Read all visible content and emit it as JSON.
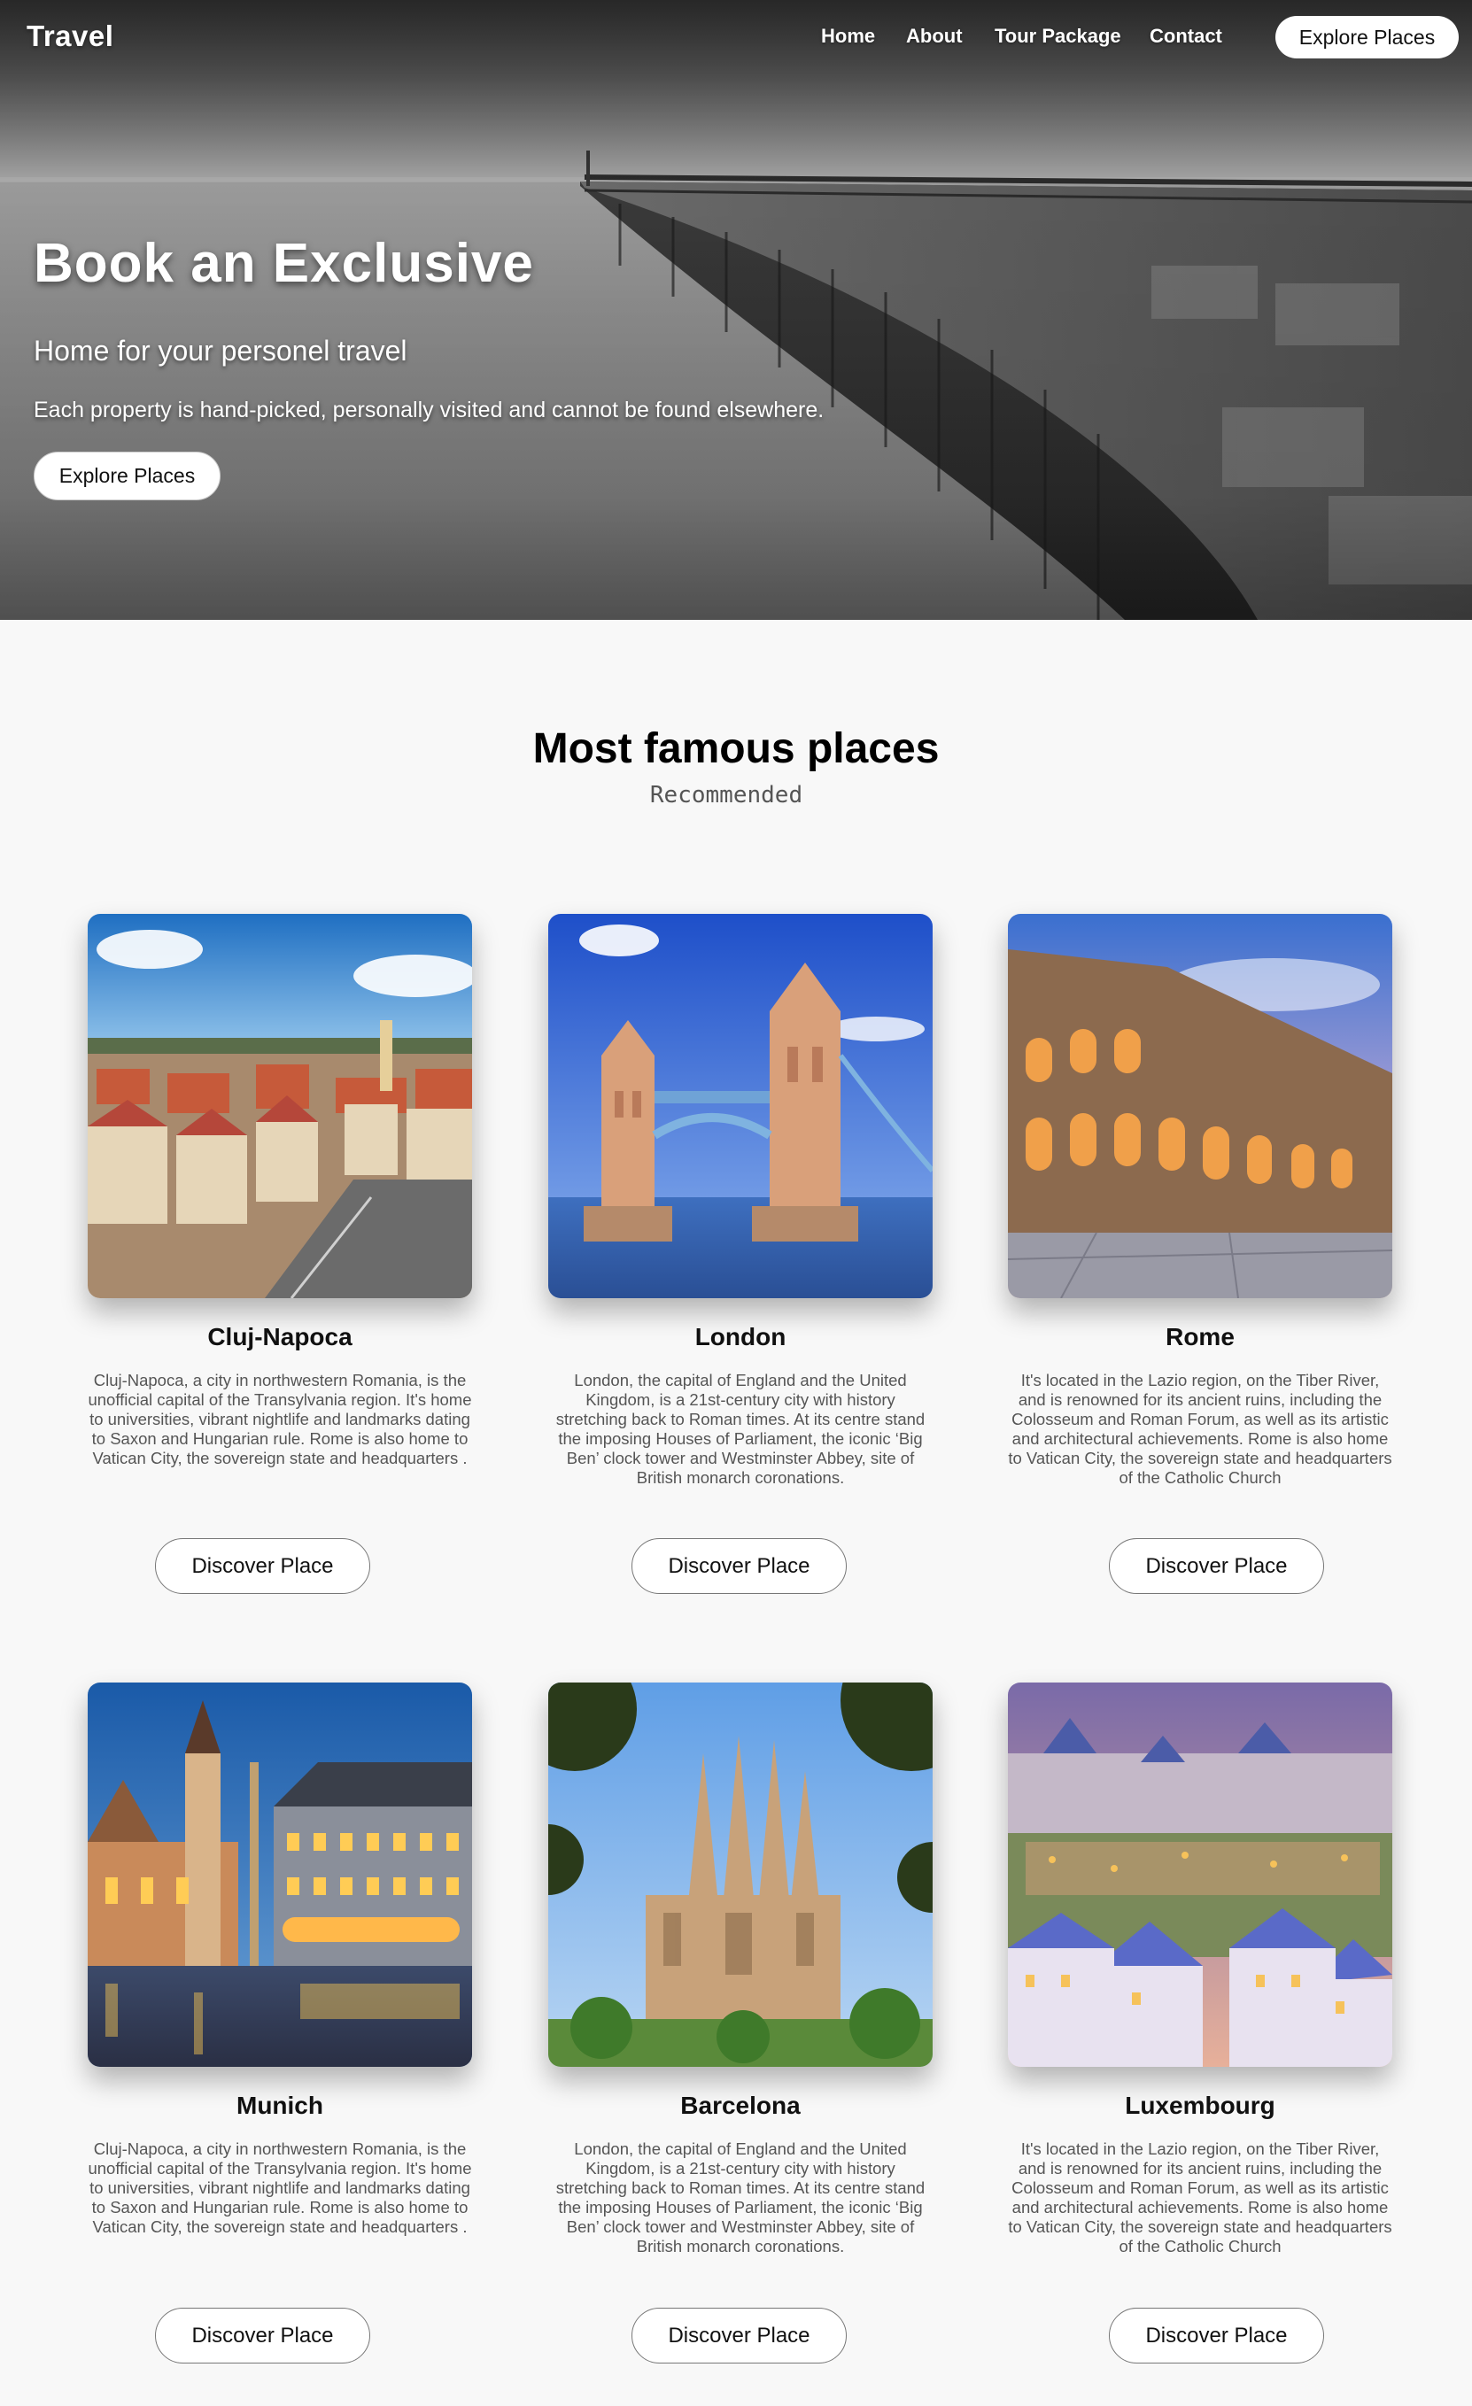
{
  "nav": {
    "logo": "Travel",
    "links": [
      "Home",
      "About",
      "Tour Package",
      "Contact"
    ],
    "cta": "Explore Places"
  },
  "hero": {
    "title": "Book an Exclusive",
    "subtitle": "Home for your personel travel",
    "description": "Each property is hand-picked, personally visited and cannot be found elsewhere.",
    "cta": "Explore Places"
  },
  "section": {
    "title": "Most famous places",
    "subtitle": "Recommended"
  },
  "places": [
    {
      "name": "Cluj-Napoca",
      "description": "Cluj-Napoca, a city in northwestern Romania, is the unofficial capital of the Transylvania region. It's home to universities, vibrant nightlife and landmarks dating to Saxon and Hungarian rule. Rome is also home to Vatican City, the sovereign state and headquarters .",
      "button": "Discover Place"
    },
    {
      "name": "London",
      "description": "London, the capital of England and the United Kingdom, is a 21st-century city with history stretching back to Roman times. At its centre stand the imposing Houses of Parliament, the iconic ‘Big Ben’ clock tower and Westminster Abbey, site of British monarch coronations.",
      "button": "Discover Place"
    },
    {
      "name": "Rome",
      "description": "It's located in the Lazio region, on the Tiber River, and is renowned for its ancient ruins, including the Colosseum and Roman Forum, as well as its artistic and architectural achievements. Rome is also home to Vatican City, the sovereign state and headquarters of the Catholic Church",
      "button": "Discover Place"
    },
    {
      "name": "Munich",
      "description": "Cluj-Napoca, a city in northwestern Romania, is the unofficial capital of the Transylvania region. It's home to universities, vibrant nightlife and landmarks dating to Saxon and Hungarian rule. Rome is also home to Vatican City, the sovereign state and headquarters .",
      "button": "Discover Place"
    },
    {
      "name": "Barcelona",
      "description": "London, the capital of England and the United Kingdom, is a 21st-century city with history stretching back to Roman times. At its centre stand the imposing Houses of Parliament, the iconic ‘Big Ben’ clock tower and Westminster Abbey, site of British monarch coronations.",
      "button": "Discover Place"
    },
    {
      "name": "Luxembourg",
      "description": "It's located in the Lazio region, on the Tiber River, and is renowned for its ancient ruins, including the Colosseum and Roman Forum, as well as its artistic and architectural achievements. Rome is also home to Vatican City, the sovereign state and headquarters of the Catholic Church",
      "button": "Discover Place"
    }
  ]
}
